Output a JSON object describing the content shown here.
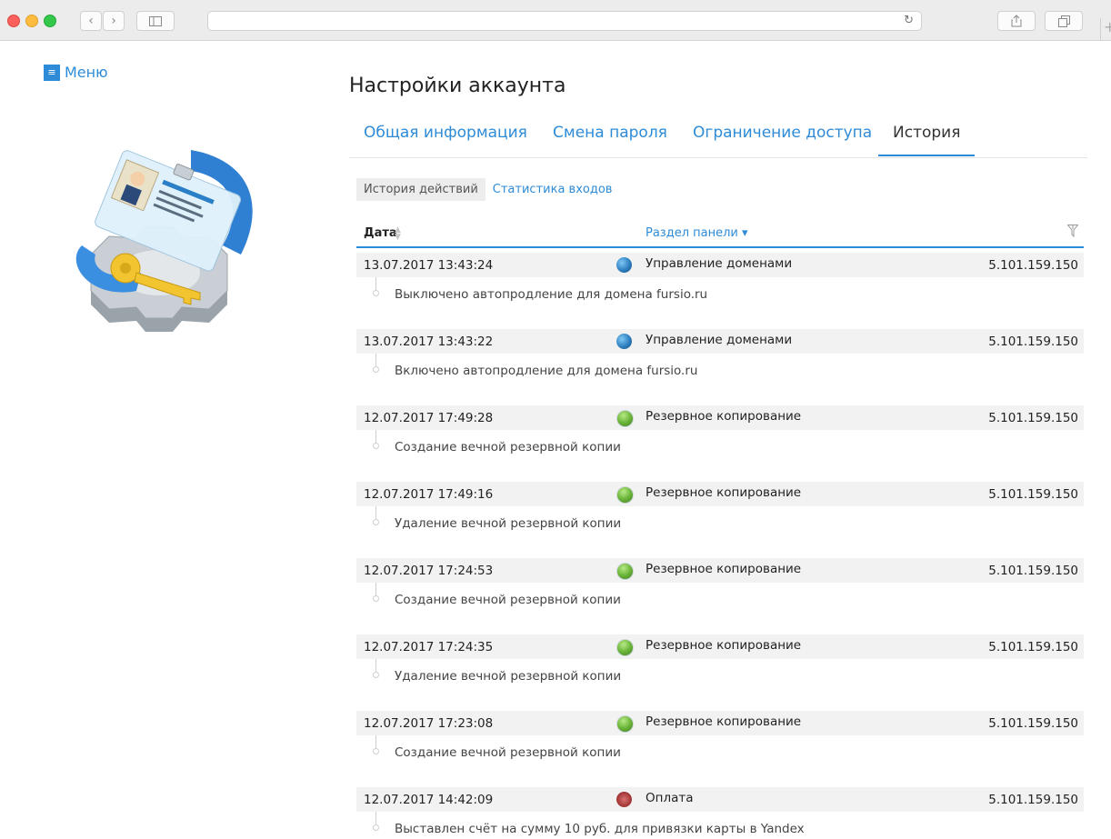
{
  "menu": {
    "label": "Меню"
  },
  "page": {
    "title": "Настройки аккаунта"
  },
  "tabs": [
    {
      "label": "Общая информация"
    },
    {
      "label": "Смена пароля"
    },
    {
      "label": "Ограничение доступа"
    },
    {
      "label": "История"
    }
  ],
  "subtabs": [
    {
      "label": "История действий"
    },
    {
      "label": "Статистика входов"
    }
  ],
  "table": {
    "col_date": "Дата",
    "col_section": "Раздел панели",
    "sort_icon": "sort-arrows-icon",
    "filter_icon": "filter-icon",
    "entries": [
      {
        "date": "13.07.2017 13:43:24",
        "icon": "domain-globe-icon",
        "section": "Управление доменами",
        "ip": "5.101.159.150",
        "desc": "Выключено автопродление для домена fursio.ru"
      },
      {
        "date": "13.07.2017 13:43:22",
        "icon": "domain-globe-icon",
        "section": "Управление доменами",
        "ip": "5.101.159.150",
        "desc": "Включено автопродление для домена fursio.ru"
      },
      {
        "date": "12.07.2017 17:49:28",
        "icon": "backup-icon",
        "section": "Резервное копирование",
        "ip": "5.101.159.150",
        "desc": "Создание вечной резервной копии"
      },
      {
        "date": "12.07.2017 17:49:16",
        "icon": "backup-icon",
        "section": "Резервное копирование",
        "ip": "5.101.159.150",
        "desc": "Удаление вечной резервной копии"
      },
      {
        "date": "12.07.2017 17:24:53",
        "icon": "backup-icon",
        "section": "Резервное копирование",
        "ip": "5.101.159.150",
        "desc": "Создание вечной резервной копии"
      },
      {
        "date": "12.07.2017 17:24:35",
        "icon": "backup-icon",
        "section": "Резервное копирование",
        "ip": "5.101.159.150",
        "desc": "Удаление вечной резервной копии"
      },
      {
        "date": "12.07.2017 17:23:08",
        "icon": "backup-icon",
        "section": "Резервное копирование",
        "ip": "5.101.159.150",
        "desc": "Создание вечной резервной копии"
      },
      {
        "date": "12.07.2017 14:42:09",
        "icon": "payment-icon",
        "section": "Оплата",
        "ip": "5.101.159.150",
        "desc": "Выставлен счёт на сумму 10 руб. для привязки карты в Yandex"
      }
    ]
  },
  "colors": {
    "accent": "#2e8bd7",
    "row_bg": "#f2f2f2"
  }
}
